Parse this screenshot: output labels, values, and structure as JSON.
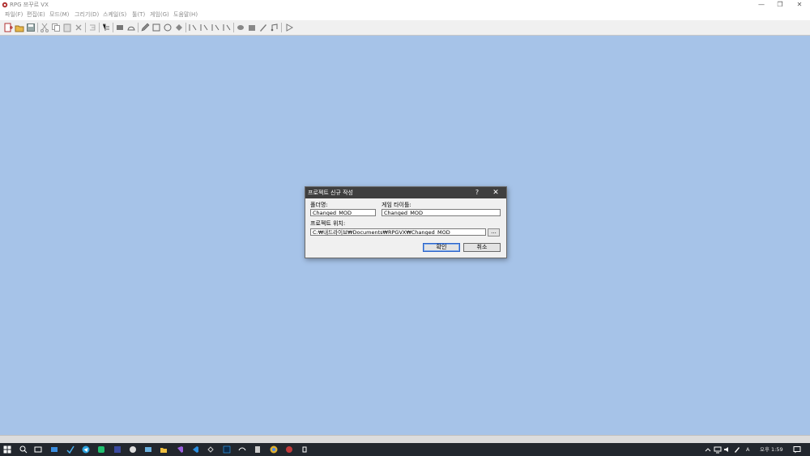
{
  "window": {
    "title": "RPG 쯔꾸르 VX",
    "minimize_glyph": "—",
    "restore_glyph": "❐",
    "close_glyph": "✕"
  },
  "menu": [
    {
      "label": "파일(F)"
    },
    {
      "label": "편집(E)"
    },
    {
      "label": "모드(M)"
    },
    {
      "label": "그리기(D)"
    },
    {
      "label": "스케일(S)"
    },
    {
      "label": "툴(T)"
    },
    {
      "label": "게임(G)"
    },
    {
      "label": "도움말(H)"
    }
  ],
  "dialog": {
    "title": "프로젝트 신규 작성",
    "help_glyph": "?",
    "close_glyph": "✕",
    "folder_label": "폴더명:",
    "folder_value": "Changed_MOD",
    "game_title_label": "게임 타이틀:",
    "game_title_value": "Changed_MOD",
    "location_label": "프로젝트 위치:",
    "location_value": "C:₩내드라이브₩Documents₩RPGVX₩Changed_MOD",
    "browse_label": "...",
    "ok_label": "확인",
    "cancel_label": "취소"
  },
  "taskbar": {
    "input_mode": "A",
    "time": "오후 1:59"
  },
  "colors": {
    "workspace": "#a6c3e8",
    "dialog_title_bar": "#3f3f3f",
    "taskbar": "#22272e"
  }
}
